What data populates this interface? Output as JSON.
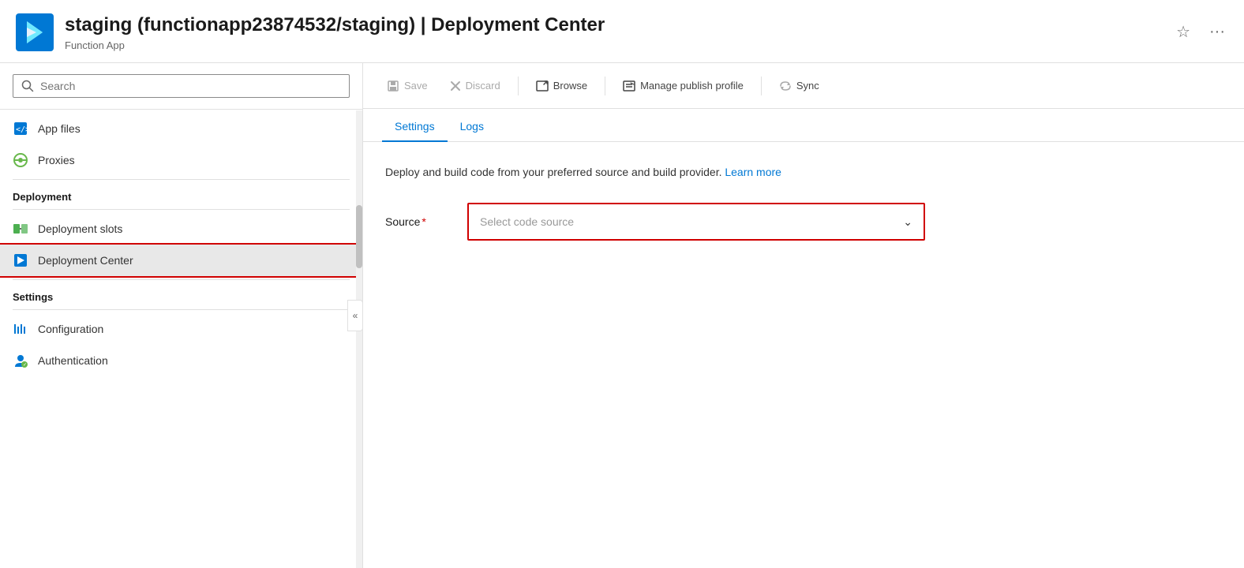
{
  "header": {
    "title": "staging (functionapp23874532/staging) | Deployment Center",
    "subtitle": "Function App",
    "star_label": "☆",
    "ellipsis_label": "···"
  },
  "toolbar": {
    "save_label": "Save",
    "discard_label": "Discard",
    "browse_label": "Browse",
    "manage_publish_label": "Manage publish profile",
    "sync_label": "Sync",
    "collapse_label": "«"
  },
  "tabs": {
    "settings_label": "Settings",
    "logs_label": "Logs"
  },
  "main": {
    "description": "Deploy and build code from your preferred source and build provider.",
    "learn_more_label": "Learn more",
    "source_label": "Source",
    "source_placeholder": "Select code source"
  },
  "sidebar": {
    "search_placeholder": "Search",
    "items": [
      {
        "id": "app-files",
        "label": "App files",
        "icon": "app-files-icon",
        "section": null
      },
      {
        "id": "proxies",
        "label": "Proxies",
        "icon": "proxies-icon",
        "section": null
      },
      {
        "id": "deployment-section",
        "label": "Deployment",
        "type": "section"
      },
      {
        "id": "deployment-slots",
        "label": "Deployment slots",
        "icon": "deployment-slots-icon",
        "section": "Deployment"
      },
      {
        "id": "deployment-center",
        "label": "Deployment Center",
        "icon": "deployment-center-icon",
        "section": "Deployment",
        "active": true
      },
      {
        "id": "settings-section",
        "label": "Settings",
        "type": "section"
      },
      {
        "id": "configuration",
        "label": "Configuration",
        "icon": "configuration-icon",
        "section": "Settings"
      },
      {
        "id": "authentication",
        "label": "Authentication",
        "icon": "authentication-icon",
        "section": "Settings"
      }
    ]
  }
}
